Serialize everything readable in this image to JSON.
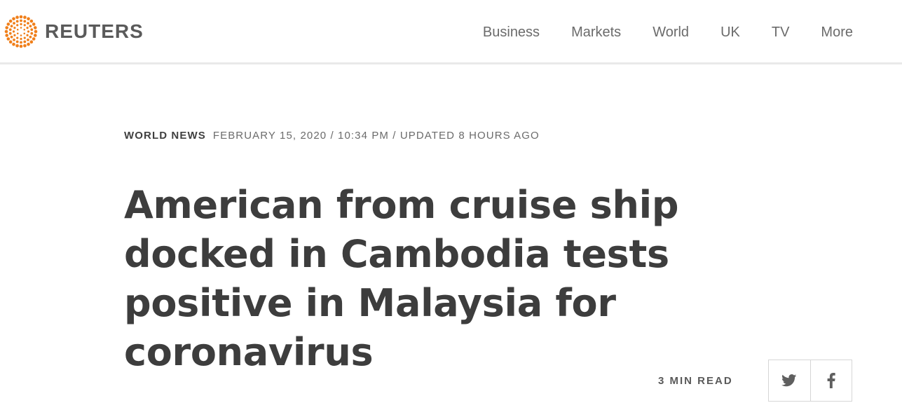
{
  "header": {
    "brand": "REUTERS",
    "nav": [
      {
        "label": "Business"
      },
      {
        "label": "Markets"
      },
      {
        "label": "World"
      },
      {
        "label": "UK"
      },
      {
        "label": "TV"
      },
      {
        "label": "More"
      }
    ]
  },
  "article": {
    "section": "WORLD NEWS",
    "dateline": "FEBRUARY 15, 2020 / 10:34 PM / UPDATED 8 HOURS AGO",
    "headline": "American from cruise ship docked in Cambodia tests positive in Malaysia for coronavirus",
    "read_time": "3 MIN READ"
  },
  "share": {
    "buttons": [
      {
        "icon": "twitter-icon"
      },
      {
        "icon": "facebook-icon"
      }
    ]
  },
  "colors": {
    "brand_orange": "#f07f1a",
    "text_dark": "#404040",
    "text_muted": "#6b6b6b",
    "divider": "#e9e9e9"
  }
}
